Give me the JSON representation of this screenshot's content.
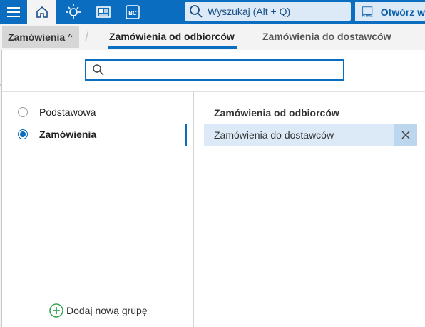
{
  "topbar": {
    "search_placeholder": "Wyszukaj (Alt + Q)",
    "html_badge": "HTML",
    "open_label": "Otwórz w",
    "bc_label": "BC"
  },
  "subnav": {
    "module_label": "Zamówienia",
    "tabs": [
      {
        "label": "Zamówienia od odbiorców",
        "active": true
      },
      {
        "label": "Zamówienia do dostawców",
        "active": false
      }
    ]
  },
  "filter": {
    "value": ""
  },
  "groups": [
    {
      "label": "Podstawowa",
      "selected": false
    },
    {
      "label": "Zamówienia",
      "selected": true
    }
  ],
  "add_group_label": "Dodaj nową grupę",
  "right": {
    "title": "Zamówienia od odbiorców",
    "items": [
      {
        "label": "Zamówienia do dostawców"
      }
    ]
  },
  "colors": {
    "accent": "#0a6dbf",
    "selection_bg": "#dceaf7",
    "add_icon": "#3aa655"
  }
}
